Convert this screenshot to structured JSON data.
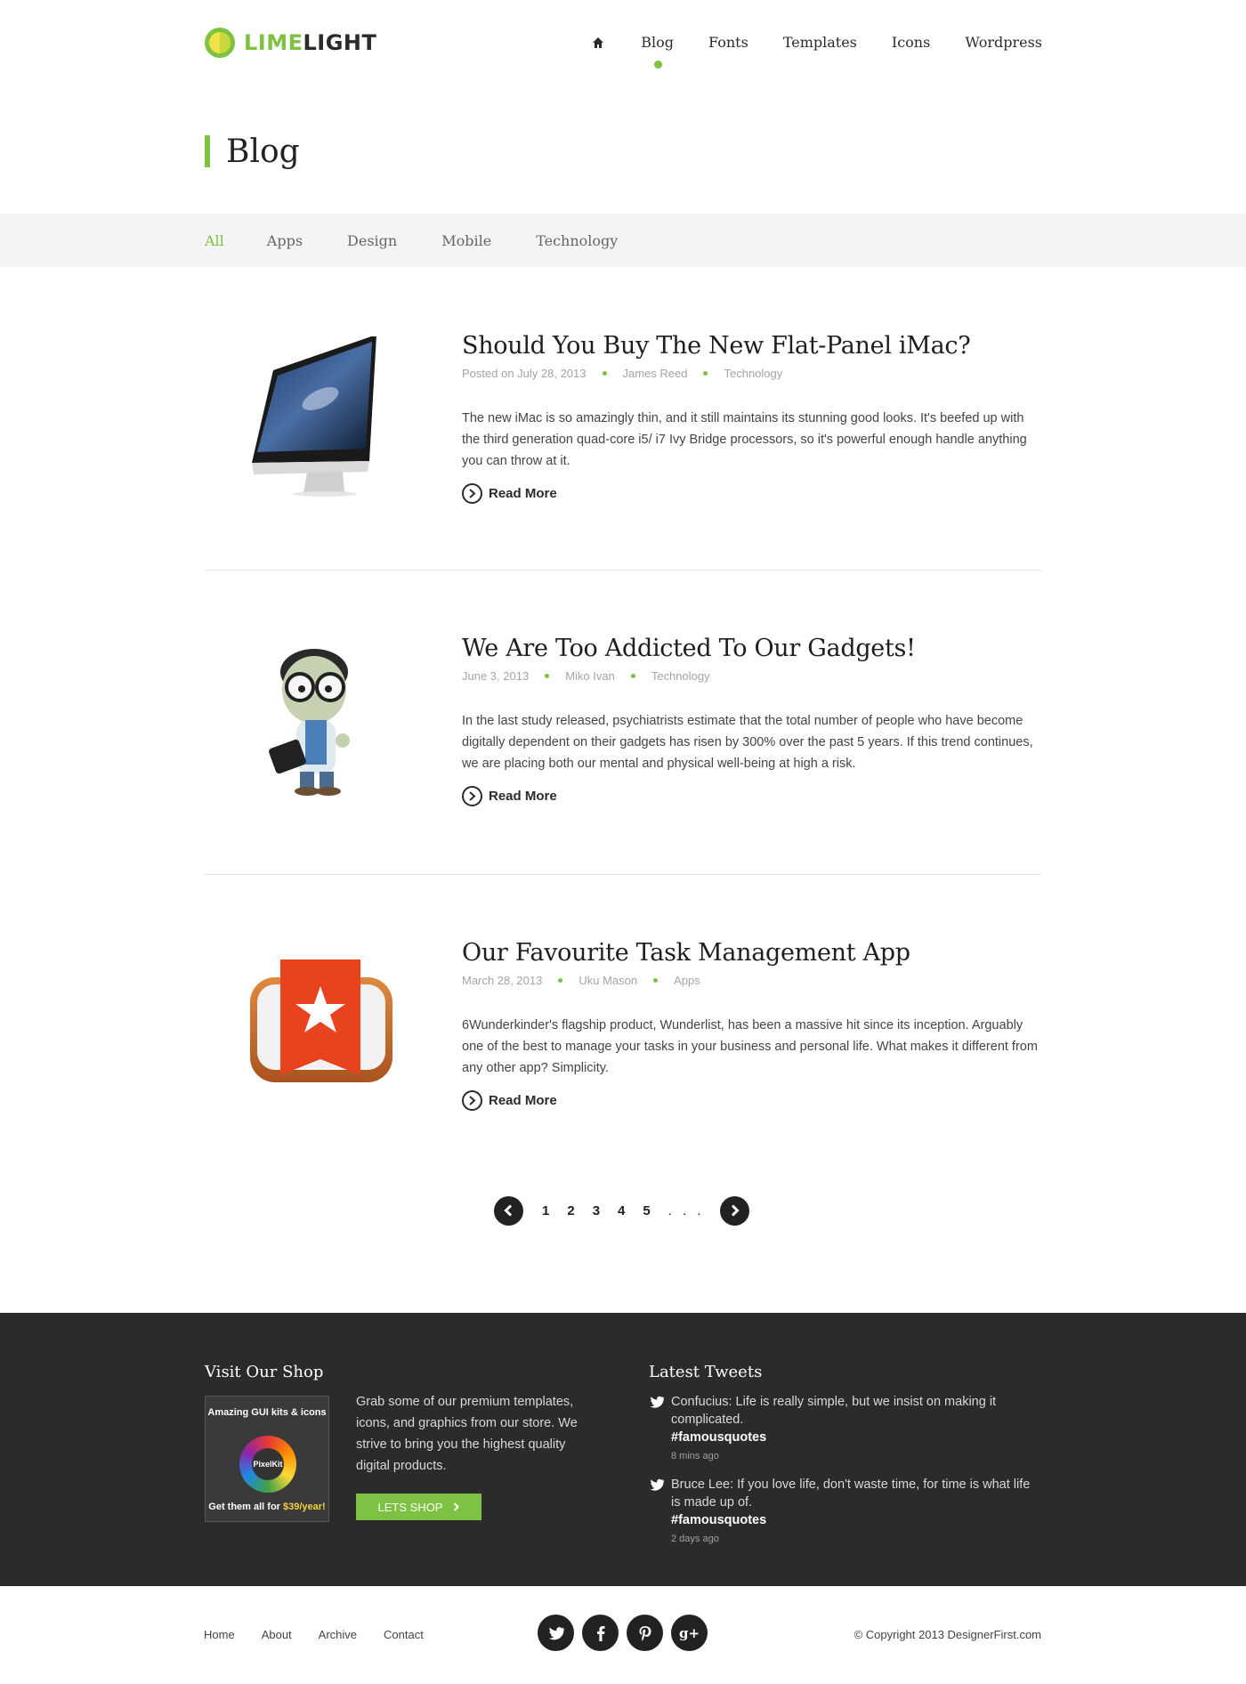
{
  "brand": {
    "name_part1": "LIME",
    "name_part2": "LIGHT",
    "accent_color": "#7dc242"
  },
  "nav": {
    "home_icon": "home-icon",
    "items": [
      {
        "label": "Blog",
        "active": true
      },
      {
        "label": "Fonts",
        "active": false
      },
      {
        "label": "Templates",
        "active": false
      },
      {
        "label": "Icons",
        "active": false
      },
      {
        "label": "Wordpress",
        "active": false
      }
    ]
  },
  "page": {
    "title": "Blog"
  },
  "filters": [
    {
      "label": "All",
      "active": true
    },
    {
      "label": "Apps",
      "active": false
    },
    {
      "label": "Design",
      "active": false
    },
    {
      "label": "Mobile",
      "active": false
    },
    {
      "label": "Technology",
      "active": false
    }
  ],
  "posts": [
    {
      "title": "Should You Buy The New Flat-Panel iMac?",
      "date": "Posted on July 28, 2013",
      "author": "James Reed",
      "category": "Technology",
      "excerpt": "The new iMac is so amazingly thin, and it still maintains its stunning good looks. It's beefed up with the third generation quad-core i5/ i7 Ivy Bridge processors, so it's powerful enough handle anything you can throw at it.",
      "read_more": "Read More",
      "image": "imac-image"
    },
    {
      "title": "We Are Too Addicted To Our Gadgets!",
      "date": "June 3, 2013",
      "author": "Miko Ivan",
      "category": "Technology",
      "excerpt": "In the last study released, psychiatrists estimate that the total number of people who have become digitally dependent on their gadgets has risen by 300% over the past 5 years. If this trend continues, we are placing both our mental and physical well-being at high a risk.",
      "read_more": "Read More",
      "image": "gadget-character-image"
    },
    {
      "title": "Our Favourite Task Management App",
      "date": "March 28, 2013",
      "author": "Uku Mason",
      "category": "Apps",
      "excerpt": "6Wunderkinder's flagship product, Wunderlist, has been a massive hit since its inception. Arguably one of the best to manage your tasks in your business and personal life. What makes it different from any other app? Simplicity.",
      "read_more": "Read More",
      "image": "wunderlist-app-icon-image"
    }
  ],
  "pagination": {
    "pages": [
      "1",
      "2",
      "3",
      "4",
      "5"
    ],
    "ellipsis": ". . .",
    "prev_icon": "chevron-left-icon",
    "next_icon": "chevron-right-icon"
  },
  "shop": {
    "title": "Visit Our Shop",
    "banner_top": "Amazing GUI kits & icons",
    "banner_logo": "PixelKit",
    "banner_bottom_prefix": "Get them all for ",
    "banner_price": "$39/year!",
    "text": "Grab some of our premium templates, icons, and graphics from our store. We strive to bring you the highest quality digital products.",
    "button_label": "LETS SHOP"
  },
  "tweets": {
    "title": "Latest Tweets",
    "items": [
      {
        "text": "Confucius: Life is really simple, but we insist on making it complicated.",
        "tag": "#famousquotes",
        "time": "8 mins ago"
      },
      {
        "text": "Bruce Lee: If you love life, don't waste time, for time is what life is made up of.",
        "tag": "#famousquotes",
        "time": "2 days ago"
      }
    ]
  },
  "footer": {
    "links": [
      "Home",
      "About",
      "Archive",
      "Contact"
    ],
    "social": [
      {
        "icon": "twitter-icon",
        "glyph": "t"
      },
      {
        "icon": "facebook-icon",
        "glyph": "f"
      },
      {
        "icon": "pinterest-icon",
        "glyph": "p"
      },
      {
        "icon": "google-plus-icon",
        "glyph": "g+"
      }
    ],
    "copyright": "© Copyright 2013 DesignerFirst.com"
  }
}
